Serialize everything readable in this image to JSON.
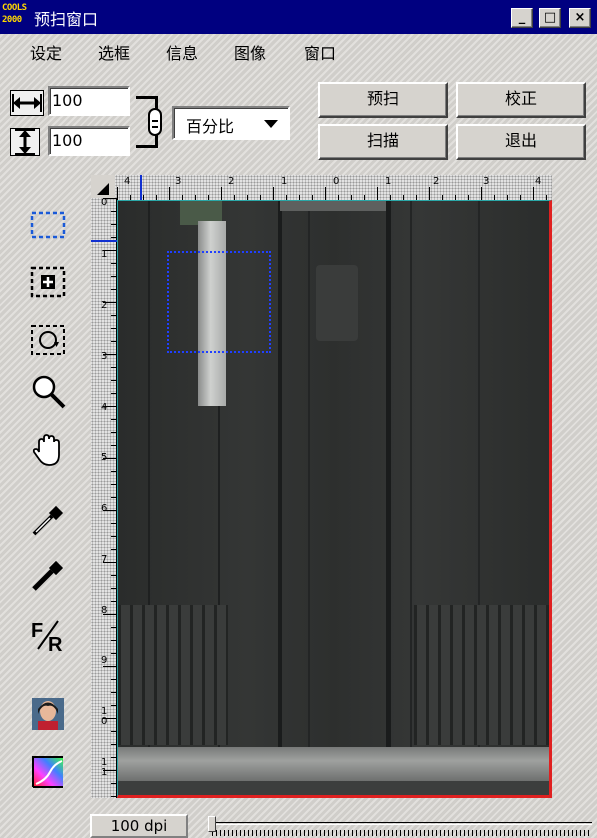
{
  "window": {
    "title": "预扫窗口",
    "logo_lines": [
      "COOLS",
      "2000"
    ],
    "minimize_glyph": "_",
    "maximize_glyph": "□",
    "close_glyph": "×"
  },
  "menu": [
    "设定",
    "选框",
    "信息",
    "图像",
    "窗口"
  ],
  "size_controls": {
    "width_value": "100",
    "height_value": "100",
    "unit_selected": "百分比"
  },
  "buttons": {
    "prescan": "预扫",
    "calibrate": "校正",
    "scan": "扫描",
    "exit": "退出"
  },
  "ruler": {
    "h_labels": [
      "4",
      "3",
      "2",
      "1",
      "0",
      "1",
      "2",
      "3",
      "4"
    ],
    "v_labels": [
      "0",
      "1",
      "2",
      "3",
      "4",
      "5",
      "6",
      "7",
      "8",
      "9",
      "1\n0",
      "1\n1"
    ]
  },
  "tools": [
    {
      "icon": "selection-marquee-icon"
    },
    {
      "icon": "add-selection-icon"
    },
    {
      "icon": "auto-crop-icon"
    },
    {
      "icon": "zoom-icon"
    },
    {
      "icon": "hand-pan-icon"
    },
    {
      "icon": "eyedropper-white-icon"
    },
    {
      "icon": "eyedropper-black-icon"
    },
    {
      "icon": "film-reverse-icon"
    },
    {
      "icon": "image-adjust-icon"
    },
    {
      "icon": "color-curve-icon"
    }
  ],
  "ftr_letters": [
    "F",
    "R"
  ],
  "status": {
    "resolution": "100 dpi"
  },
  "colors": {
    "titlebar": "#000080",
    "selection": "#2040ff",
    "preview_border": "#e02020"
  }
}
